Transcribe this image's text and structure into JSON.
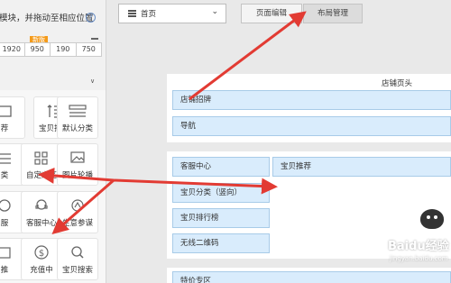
{
  "sidebar": {
    "hint": "模块，并拖动至相应位置",
    "new_badge": "新版",
    "widths": [
      "1920",
      "950",
      "190",
      "750"
    ],
    "modules": [
      {
        "label": "荐",
        "icon": "thumb-icon"
      },
      {
        "label": "宝贝排行",
        "icon": "ranking-icon"
      },
      {
        "label": "默认分类",
        "icon": "category-icon"
      },
      {
        "label": "类",
        "icon": "category-icon"
      },
      {
        "label": "自定义区",
        "icon": "custom-area-icon"
      },
      {
        "label": "图片轮播",
        "icon": "image-carousel-icon"
      },
      {
        "label": "服",
        "icon": "service-icon"
      },
      {
        "label": "客服中心",
        "icon": "customer-service-icon"
      },
      {
        "label": "生意参谋",
        "icon": "business-advisor-icon"
      },
      {
        "label": "推",
        "icon": "promo-icon"
      },
      {
        "label": "充值中",
        "icon": "dollar-icon"
      },
      {
        "label": "宝贝搜索",
        "icon": "search-icon"
      }
    ]
  },
  "toolbar": {
    "page_select": "首页",
    "tabs": [
      "页面编辑",
      "布局管理"
    ]
  },
  "canvas": {
    "header_title": "店铺页头",
    "header_modules": [
      "店铺招牌",
      "导航"
    ],
    "left_modules": [
      "客服中心",
      "宝贝分类（竖向）",
      "宝贝排行榜",
      "无线二维码"
    ],
    "right_modules": [
      "宝贝推荐"
    ],
    "footer_title": "特价专区"
  },
  "watermark": {
    "text": "Baidu经验",
    "sub": "jingyan.baidu.com"
  },
  "colors": {
    "module_bg": "#d9ecfc",
    "module_border": "#a8cbe8",
    "arrow": "#e23b33",
    "badge": "#f49b1b"
  }
}
